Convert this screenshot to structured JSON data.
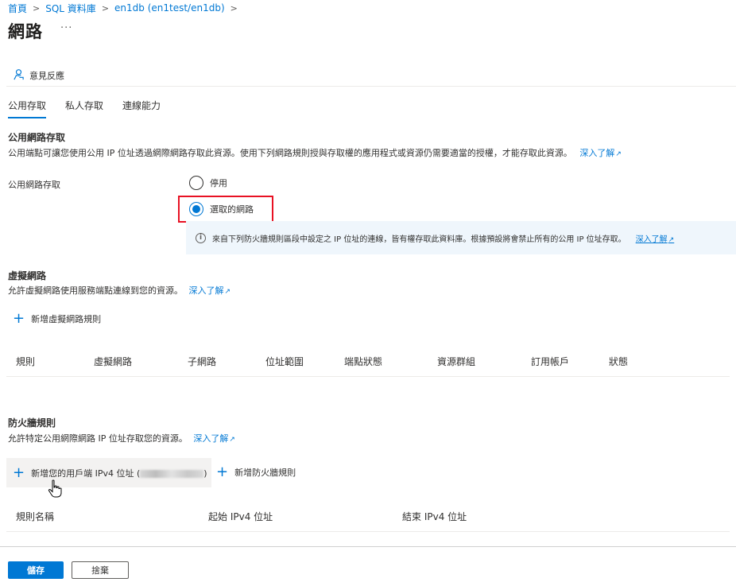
{
  "breadcrumb": {
    "items": [
      "首頁",
      "SQL 資料庫",
      "en1db (en1test/en1db)"
    ],
    "separator": ">"
  },
  "page": {
    "title": "網路",
    "more_label": "···"
  },
  "toolbar": {
    "feedback_label": "意見反應"
  },
  "tabs": [
    {
      "label": "公用存取",
      "active": true
    },
    {
      "label": "私人存取",
      "active": false
    },
    {
      "label": "連線能力",
      "active": false
    }
  ],
  "public_access": {
    "title": "公用網路存取",
    "description": "公用端點可讓您使用公用 IP 位址透過網際網路存取此資源。使用下列網路規則授與存取權的應用程式或資源仍需要適當的授權，才能存取此資源。",
    "learn_more": "深入了解",
    "field_label": "公用網路存取",
    "options": [
      {
        "label": "停用",
        "selected": false
      },
      {
        "label": "選取的網路",
        "selected": true
      }
    ],
    "info_text": "來自下列防火牆規則區段中設定之 IP 位址的連線，皆有權存取此資料庫。根據預設將會禁止所有的公用 IP 位址存取。",
    "info_link": "深入了解"
  },
  "virtual_networks": {
    "title": "虛擬網路",
    "description": "允許虛擬網路使用服務端點連線到您的資源。",
    "learn_more": "深入了解",
    "add_label": "新增虛擬網路規則",
    "columns": [
      "規則",
      "虛擬網路",
      "子網路",
      "位址範圍",
      "端點狀態",
      "資源群組",
      "訂用帳戶",
      "狀態"
    ]
  },
  "firewall": {
    "title": "防火牆規則",
    "description": "允許特定公用網際網路 IP 位址存取您的資源。",
    "learn_more": "深入了解",
    "add_client_label_prefix": "新增您的用戶端 IPv4 位址 (",
    "add_client_label_suffix": ")",
    "add_rule_label": "新增防火牆規則",
    "columns": [
      "規則名稱",
      "起始 IPv4 位址",
      "結束 IPv4 位址"
    ]
  },
  "footer": {
    "save_label": "儲存",
    "discard_label": "捨棄"
  },
  "colors": {
    "accent": "#0078d4",
    "highlight_border": "#e81123",
    "info_bg": "#eff6fc"
  },
  "icons": {
    "feedback": "feedback-icon",
    "info": "info-icon",
    "add": "plus-icon",
    "external": "external-link-icon",
    "cursor": "hand-cursor-icon"
  }
}
